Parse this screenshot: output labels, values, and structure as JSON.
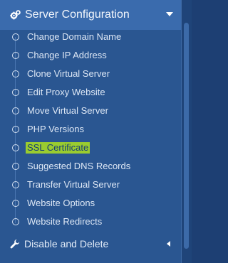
{
  "header": {
    "title": "Server Configuration",
    "icon": "cogs-icon",
    "caret_icon": "caret-down-icon"
  },
  "menu": {
    "items": [
      {
        "label": "Change Domain Name"
      },
      {
        "label": "Change IP Address"
      },
      {
        "label": "Clone Virtual Server"
      },
      {
        "label": "Edit Proxy Website"
      },
      {
        "label": "Move Virtual Server"
      },
      {
        "label": "PHP Versions"
      },
      {
        "label": "SSL Certificate",
        "highlighted": true
      },
      {
        "label": "Suggested DNS Records"
      },
      {
        "label": "Transfer Virtual Server"
      },
      {
        "label": "Website Options"
      },
      {
        "label": "Website Redirects"
      }
    ]
  },
  "footer_section": {
    "title": "Disable and Delete",
    "icon": "wrench-icon",
    "caret_icon": "caret-left-icon"
  },
  "colors": {
    "panel": "#2a5691",
    "header": "#3a6bad",
    "highlight": "#9acc2f"
  }
}
